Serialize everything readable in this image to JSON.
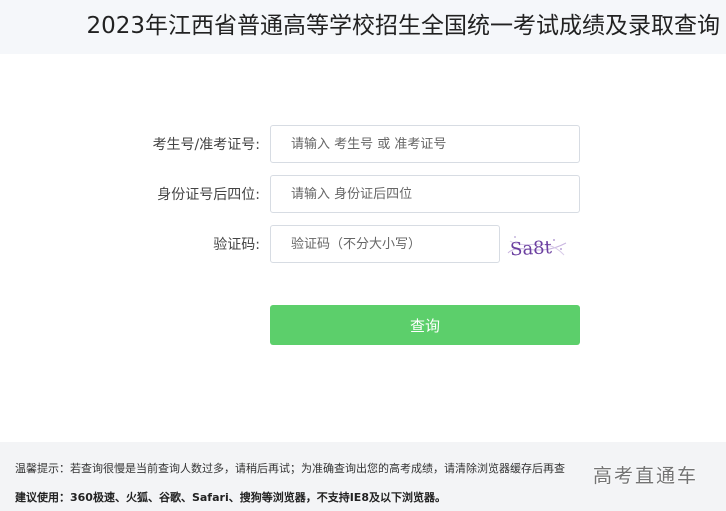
{
  "header": {
    "title": "2023年江西省普通高等学校招生全国统一考试成绩及录取查询"
  },
  "form": {
    "exam_id": {
      "label": "考生号/准考证号:",
      "placeholder": "请输入 考生号 或 准考证号"
    },
    "id_last4": {
      "label": "身份证号后四位:",
      "placeholder": "请输入 身份证后四位"
    },
    "captcha": {
      "label": "验证码:",
      "placeholder": "验证码（不分大小写）",
      "image_text": "Sa8t"
    },
    "submit_label": "查询"
  },
  "footer": {
    "tip": "温馨提示：若查询很慢是当前查询人数过多，请稍后再试；为准确查询出您的高考成绩，请清除浏览器缓存后再查",
    "advice": "建议使用：360极速、火狐、谷歌、Safari、搜狗等浏览器，不支持IE8及以下浏览器。",
    "watermark": "高考直通车"
  },
  "colors": {
    "button": "#5ccf6b",
    "header_bg": "#f5f7fa",
    "footer_bg": "#f3f4f6",
    "captcha_text": "#6b3fa0"
  }
}
